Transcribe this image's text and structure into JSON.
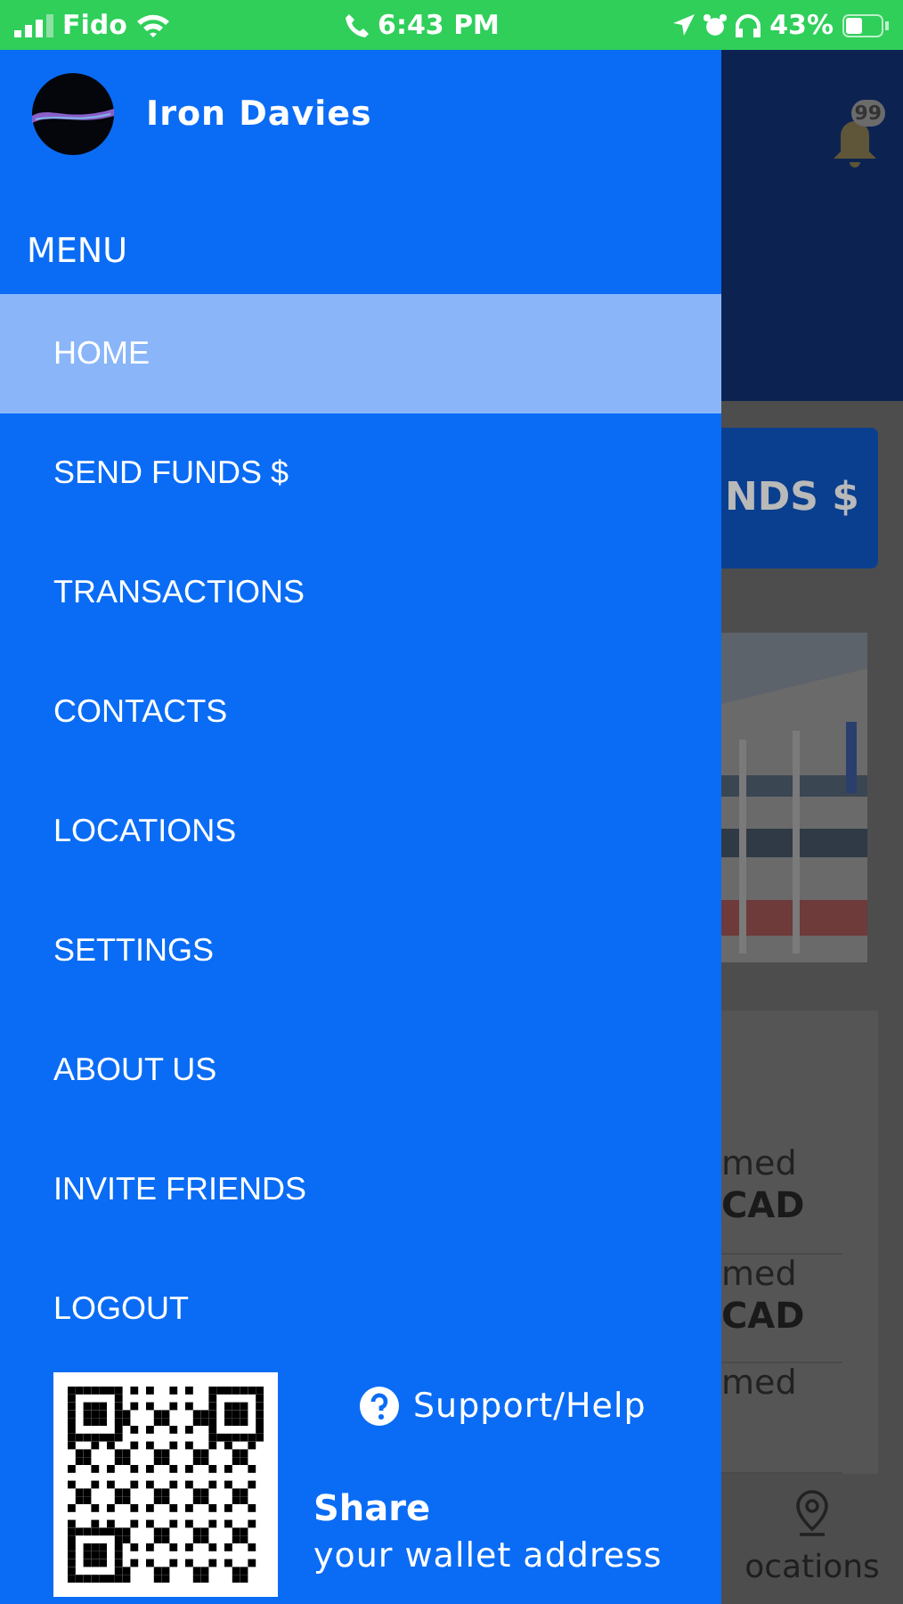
{
  "status_bar": {
    "carrier": "Fido",
    "time": "6:43 PM",
    "battery": "43%"
  },
  "drawer": {
    "user_name": "Iron Davies",
    "menu_title": "MENU",
    "items": [
      {
        "label": "HOME",
        "selected": true
      },
      {
        "label": "SEND FUNDS $",
        "selected": false
      },
      {
        "label": "TRANSACTIONS",
        "selected": false
      },
      {
        "label": "CONTACTS",
        "selected": false
      },
      {
        "label": "LOCATIONS",
        "selected": false
      },
      {
        "label": "SETTINGS",
        "selected": false
      },
      {
        "label": "ABOUT US",
        "selected": false
      },
      {
        "label": "INVITE FRIENDS",
        "selected": false
      },
      {
        "label": "LOGOUT",
        "selected": false
      }
    ],
    "support_label": "Support/Help",
    "share_title": "Share",
    "share_subtitle": "your wallet address"
  },
  "background": {
    "notification_count": "99",
    "button_label": "NDS $",
    "rows": [
      {
        "line_1": "med",
        "line_2": "CAD"
      },
      {
        "line_1": "med",
        "line_2": "CAD"
      },
      {
        "line_1": "med"
      }
    ],
    "tab_label": "ocations"
  }
}
